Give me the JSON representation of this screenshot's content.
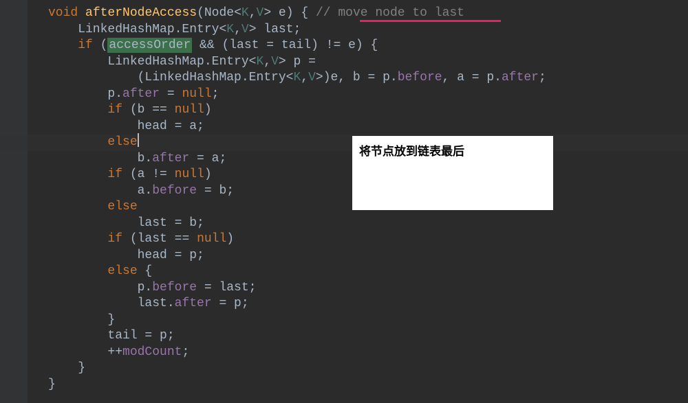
{
  "code": {
    "l1_kw": "void",
    "l1_method": "afterNodeAccess",
    "l1_sig1": "(Node<",
    "l1_g1": "K",
    "l1_comma": ",",
    "l1_g2": "V",
    "l1_sig2": "> e) { ",
    "l1_comment": "// move node to last",
    "l2": "    LinkedHashMap.Entry<",
    "l2_g1": "K",
    "l2_g2": "V",
    "l2_end": "> last;",
    "l3_if": "    if",
    "l3_p1": " (",
    "l3_hl": "accessOrder",
    "l3_p2": " && (last = tail) != e) {",
    "l4": "        LinkedHashMap.Entry<",
    "l4_g1": "K",
    "l4_g2": "V",
    "l4_end": "> p =",
    "l5_a": "            (LinkedHashMap.Entry<",
    "l5_g1": "K",
    "l5_g2": "V",
    "l5_b": ">)e, b = p.",
    "l5_f1": "before",
    "l5_c": ", a = p.",
    "l5_f2": "after",
    "l5_d": ";",
    "l6_a": "        p.",
    "l6_f": "after",
    "l6_b": " = ",
    "l6_kw": "null",
    "l6_c": ";",
    "l7_if": "        if",
    "l7_a": " (b == ",
    "l7_kw": "null",
    "l7_b": ")",
    "l8_a": "            head = a;",
    "l9_else": "        else",
    "l10_a": "            b.",
    "l10_f": "after",
    "l10_b": " = a;",
    "l11_if": "        if",
    "l11_a": " (a != ",
    "l11_kw": "null",
    "l11_b": ")",
    "l12_a": "            a.",
    "l12_f": "before",
    "l12_b": " = b;",
    "l13_else": "        else",
    "l14": "            last = b;",
    "l15_if": "        if",
    "l15_a": " (last == ",
    "l15_kw": "null",
    "l15_b": ")",
    "l16": "            head = p;",
    "l17_else": "        else",
    "l17_b": " {",
    "l18_a": "            p.",
    "l18_f": "before",
    "l18_b": " = last;",
    "l19_a": "            last.",
    "l19_f": "after",
    "l19_b": " = p;",
    "l20": "        }",
    "l21": "        tail = p;",
    "l22_a": "        ++",
    "l22_f": "modCount",
    "l22_b": ";",
    "l23": "    }",
    "l24": "}"
  },
  "tooltip": {
    "text": "将节点放到链表最后"
  }
}
